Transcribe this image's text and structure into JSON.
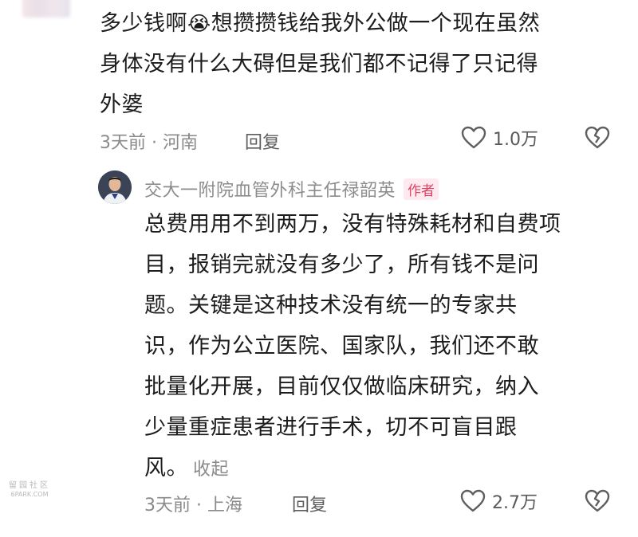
{
  "comment1": {
    "lines": [
      "多少钱啊",
      "想攒攒钱给我外公做一个现在虽然",
      "身体没有什么大碍但是我们都不记得了只记得",
      "外婆"
    ],
    "emoji": "😭",
    "time_location": "3天前 · 河南",
    "reply_label": "回复",
    "like_count": "1.0万"
  },
  "reply1": {
    "author": "交大一附院血管外科主任禄韶英",
    "author_tag": "作者",
    "lines": [
      "总费用用不到两万，没有特殊耗材和自费项",
      "目，报销完就没有多少了，所有钱不是问",
      "题。关键是这种技术没有统一的专家共",
      "识，作为公立医院、国家队，我们还不敢",
      "批量化开展，目前仅仅做临床研究，纳入",
      "少量重症患者进行手术，切不可盲目跟",
      "风。"
    ],
    "collapse_label": "收起",
    "time_location": "3天前 · 上海",
    "reply_label": "回复",
    "like_count": "2.7万"
  },
  "watermark": {
    "line1": "留园社区",
    "line2": "6PARK.COM"
  },
  "icons": {
    "like": "heart-outline-icon",
    "dislike": "broken-heart-icon",
    "emoji": "crying-face-icon"
  }
}
